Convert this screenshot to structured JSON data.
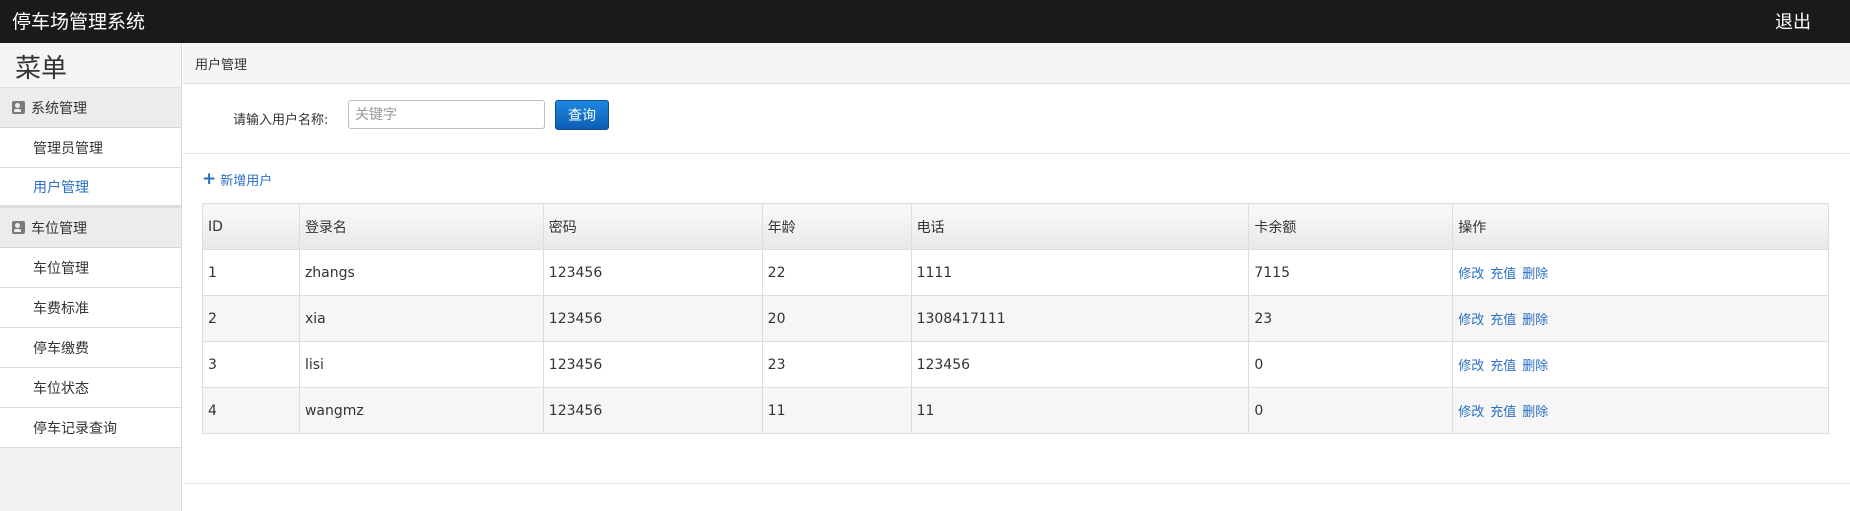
{
  "header": {
    "title": "停车场管理系统",
    "logout": "退出"
  },
  "sidebar": {
    "menu_title": "菜单",
    "groups": [
      {
        "label": "系统管理",
        "items": [
          {
            "label": "管理员管理",
            "active": false
          },
          {
            "label": "用户管理",
            "active": true
          }
        ]
      },
      {
        "label": "车位管理",
        "items": [
          {
            "label": "车位管理",
            "active": false
          },
          {
            "label": "车费标准",
            "active": false
          },
          {
            "label": "停车缴费",
            "active": false
          },
          {
            "label": "车位状态",
            "active": false
          },
          {
            "label": "停车记录查询",
            "active": false
          }
        ]
      }
    ]
  },
  "main": {
    "breadcrumb": "用户管理",
    "search": {
      "label": "请输入用户名称:",
      "placeholder": "关键字",
      "value": "",
      "button": "查询"
    },
    "add_user": "新增用户",
    "table": {
      "columns": [
        "ID",
        "登录名",
        "密码",
        "年龄",
        "电话",
        "卡余额",
        "操作"
      ],
      "rows": [
        [
          "1",
          "zhangs",
          "123456",
          "22",
          "1111",
          "7115"
        ],
        [
          "2",
          "xia",
          "123456",
          "20",
          "1308417111",
          "23"
        ],
        [
          "3",
          "lisi",
          "123456",
          "23",
          "123456",
          "0"
        ],
        [
          "4",
          "wangmz",
          "123456",
          "11",
          "11",
          "0"
        ]
      ],
      "actions": [
        "修改",
        "充值",
        "删除"
      ]
    }
  },
  "colors": {
    "topbar": "#1a1a1a",
    "link": "#2a6fc4",
    "button": "#0d6fd0"
  }
}
